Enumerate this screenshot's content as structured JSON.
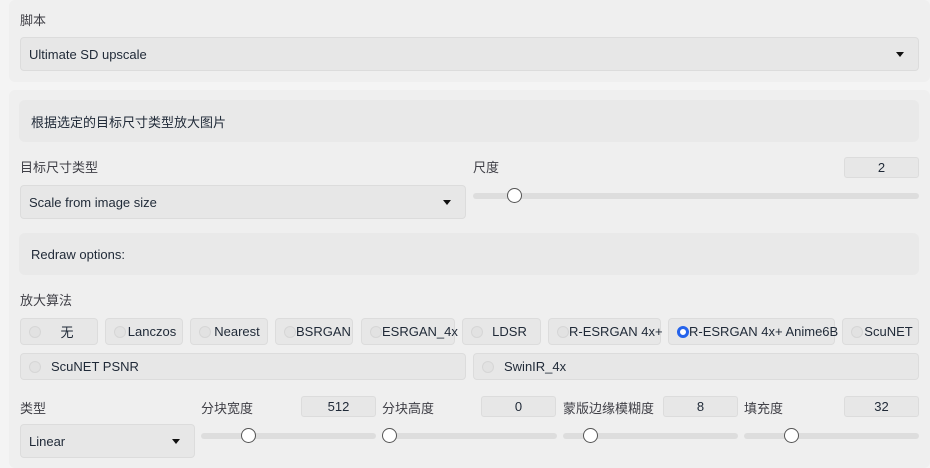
{
  "script": {
    "label": "脚本",
    "selected": "Ultimate SD upscale"
  },
  "description": "根据选定的目标尺寸类型放大图片",
  "target_size": {
    "label": "目标尺寸类型",
    "selected": "Scale from image size"
  },
  "scale": {
    "label": "尺度",
    "value": "2",
    "fraction": 0.08
  },
  "redraw": {
    "label": "Redraw options:"
  },
  "upscaler": {
    "label": "放大算法",
    "options": [
      "无",
      "Lanczos",
      "Nearest",
      "BSRGAN",
      "ESRGAN_4x",
      "LDSR",
      "R-ESRGAN 4x+",
      "R-ESRGAN 4x+ Anime6B",
      "ScuNET",
      "ScuNET PSNR",
      "SwinIR_4x"
    ],
    "selected": "R-ESRGAN 4x+ Anime6B"
  },
  "type": {
    "label": "类型",
    "selected": "Linear"
  },
  "tile_width": {
    "label": "分块宽度",
    "value": "512",
    "fraction": 0.25
  },
  "tile_height": {
    "label": "分块高度",
    "value": "0",
    "fraction": 0.0
  },
  "mask_blur": {
    "label": "蒙版边缘模糊度",
    "value": "8",
    "fraction": 0.125
  },
  "padding": {
    "label": "填充度",
    "value": "32",
    "fraction": 0.25
  },
  "colors": {
    "accent": "#2563eb",
    "panel": "#efefef",
    "field": "#e7e7e7"
  }
}
